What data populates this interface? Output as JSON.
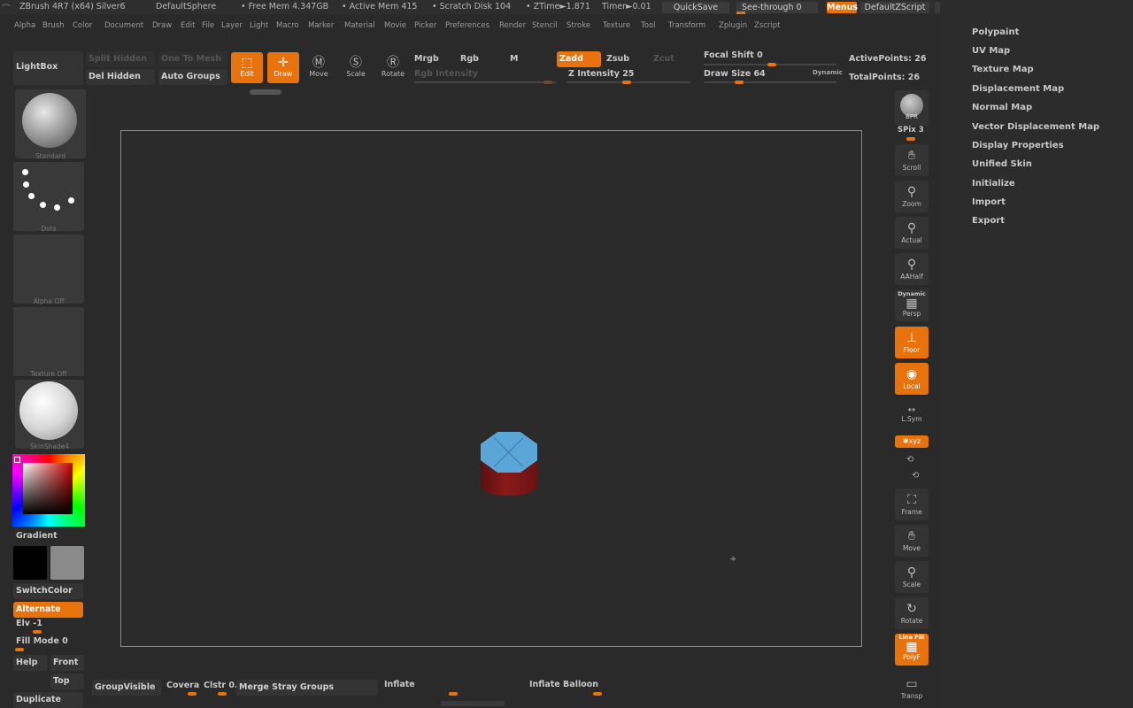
{
  "titlebar": {
    "app": "ZBrush 4R7 (x64) Silver6",
    "doc": "DefaultSphere",
    "free_mem": "• Free Mem 4.347GB",
    "active_mem": "• Active Mem 415",
    "scratch": "• Scratch Disk 104",
    "ztime": "• ZTime►1.871",
    "timer": "Timer►0.01",
    "quicksave": "QuickSave",
    "see_through": "See-through  0",
    "menus": "Menus",
    "script": "DefaultZScript"
  },
  "menubar": [
    "Alpha",
    "Brush",
    "Color",
    "Document",
    "Draw",
    "Edit",
    "File",
    "Layer",
    "Light",
    "Macro",
    "Marker",
    "Material",
    "Movie",
    "Picker",
    "Preferences",
    "Render",
    "Stencil",
    "Stroke",
    "Texture",
    "Tool",
    "Transform",
    "Zplugin",
    "Zscript"
  ],
  "shelf": {
    "lightbox": "LightBox",
    "split_hidden": "Split Hidden",
    "del_hidden": "Del Hidden",
    "one_to_mesh": "One To Mesh",
    "auto_groups": "Auto Groups",
    "edit": "Edit",
    "draw": "Draw",
    "move": "Move",
    "scale": "Scale",
    "rotate": "Rotate",
    "mrgb": "Mrgb",
    "rgb": "Rgb",
    "m": "M",
    "rgb_intensity": "Rgb Intensity",
    "zadd": "Zadd",
    "zsub": "Zsub",
    "zcut": "Zcut",
    "z_intensity": "Z Intensity 25",
    "focal_shift": "Focal Shift 0",
    "draw_size": "Draw Size 64",
    "dynamic": "Dynamic",
    "active_points": "ActivePoints: 26",
    "total_points": "TotalPoints: 26"
  },
  "left": {
    "brush": "Standard",
    "stroke": "Dots",
    "alpha": "Alpha  Off",
    "texture": "Texture  Off",
    "material": "SkinShade4",
    "gradient": "Gradient",
    "switchcolor": "SwitchColor",
    "alternate": "Alternate",
    "elv": "Elv -1",
    "fill_mode": "Fill Mode 0",
    "help": "Help",
    "front": "Front",
    "top": "Top",
    "duplicate": "Duplicate"
  },
  "right_shelf": {
    "bpr": "BPR",
    "spix": "SPix 3",
    "scroll": "Scroll",
    "zoom": "Zoom",
    "actual": "Actual",
    "aahalf": "AAHalf",
    "dynamic": "Dynamic",
    "persp": "Persp",
    "floor": "Floor",
    "local": "Local",
    "lsym": "L.Sym",
    "xyz": "✱xyz",
    "frame": "Frame",
    "move": "Move",
    "scale": "Scale",
    "rotate": "Rotate",
    "line_fill": "Line Fill",
    "polyf": "PolyF",
    "transp": "Transp"
  },
  "right_menu": [
    "Polypaint",
    "UV Map",
    "Texture Map",
    "Displacement Map",
    "Normal Map",
    "Vector Displacement Map",
    "Display Properties",
    "Unified Skin",
    "Initialize",
    "Import",
    "Export"
  ],
  "bottom": {
    "group_visible": "GroupVisible",
    "coverage": "Covera",
    "clstr": "Clstr 0.",
    "merge_stray": "Merge Stray Groups",
    "inflate": "Inflate",
    "inflate_balloon": "Inflate Balloon"
  },
  "colors": {
    "accent": "#e8720c",
    "mesh_top": "#5aa6d8",
    "mesh_side": "#8b1a1a"
  }
}
